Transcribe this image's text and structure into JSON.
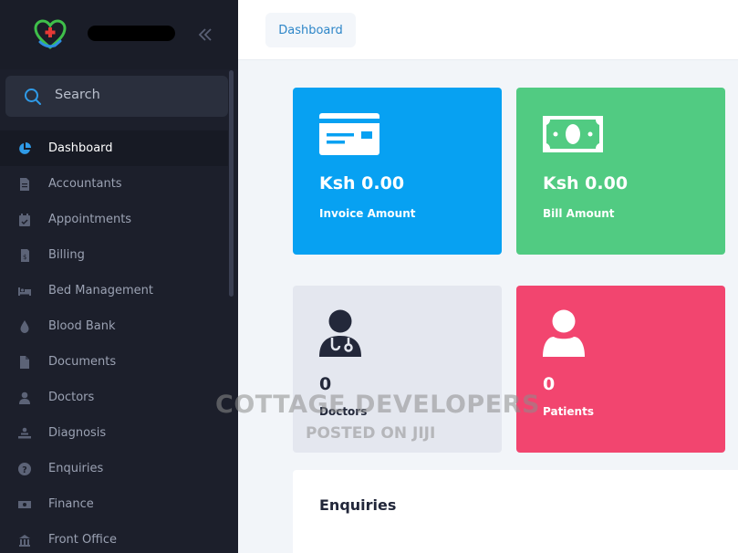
{
  "sidebar": {
    "search_label": "Search",
    "items": [
      {
        "label": "Dashboard",
        "icon": "pie-chart-icon",
        "active": true
      },
      {
        "label": "Accountants",
        "icon": "document-icon"
      },
      {
        "label": "Appointments",
        "icon": "calendar-check-icon"
      },
      {
        "label": "Billing",
        "icon": "invoice-icon"
      },
      {
        "label": "Bed Management",
        "icon": "bed-icon"
      },
      {
        "label": "Blood Bank",
        "icon": "blood-drop-icon"
      },
      {
        "label": "Documents",
        "icon": "file-icon"
      },
      {
        "label": "Doctors",
        "icon": "user-doctor-icon"
      },
      {
        "label": "Diagnosis",
        "icon": "diagnosis-icon"
      },
      {
        "label": "Enquiries",
        "icon": "question-circle-icon"
      },
      {
        "label": "Finance",
        "icon": "money-bill-icon"
      },
      {
        "label": "Front Office",
        "icon": "building-icon"
      }
    ]
  },
  "header": {
    "breadcrumb": "Dashboard"
  },
  "cards": {
    "invoice": {
      "value": "Ksh 0.00",
      "caption": "Invoice Amount"
    },
    "bill": {
      "value": "Ksh 0.00",
      "caption": "Bill Amount"
    },
    "doctors": {
      "value": "0",
      "caption": "Doctors"
    },
    "patients": {
      "value": "0",
      "caption": "Patients"
    }
  },
  "enquiries": {
    "title": "Enquiries"
  },
  "watermark": {
    "line1": "COTTAGE DEVELOPERS",
    "line2": "POSTED ON JIJI"
  },
  "colors": {
    "sidebar": "#1c1f2b",
    "invoice": "#07a1f2",
    "bill": "#51cb82",
    "doctors": "#e4e7ef",
    "patients": "#f2456f",
    "accent": "#2d86c8"
  }
}
